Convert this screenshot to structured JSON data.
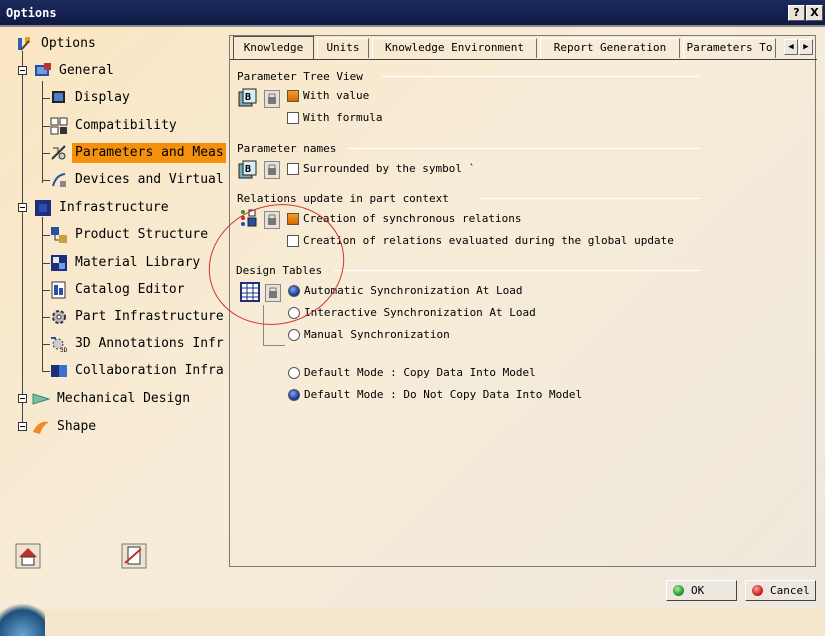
{
  "window": {
    "title": "Options",
    "help_button": "?",
    "close_button": "X"
  },
  "tree": {
    "root": "Options",
    "items": [
      {
        "label": "General",
        "icon": "general-icon"
      },
      {
        "label": "Display",
        "icon": "display-icon"
      },
      {
        "label": "Compatibility",
        "icon": "compatibility-icon"
      },
      {
        "label": "Parameters and Meas",
        "icon": "parameters-icon"
      },
      {
        "label": "Devices and Virtual",
        "icon": "devices-icon"
      },
      {
        "label": "Infrastructure",
        "icon": "infrastructure-icon"
      },
      {
        "label": "Product Structure",
        "icon": "product-structure-icon"
      },
      {
        "label": "Material Library",
        "icon": "material-library-icon"
      },
      {
        "label": "Catalog Editor",
        "icon": "catalog-editor-icon"
      },
      {
        "label": "Part Infrastructure",
        "icon": "part-infrastructure-icon"
      },
      {
        "label": "3D Annotations Infr",
        "icon": "annotations-icon"
      },
      {
        "label": "Collaboration Infra",
        "icon": "collaboration-icon"
      },
      {
        "label": "Mechanical Design",
        "icon": "mechanical-design-icon"
      },
      {
        "label": "Shape",
        "icon": "shape-icon"
      }
    ]
  },
  "tabs": [
    "Knowledge",
    "Units",
    "Knowledge Environment",
    "Report Generation",
    "Parameters To"
  ],
  "groups": {
    "tree_view": {
      "title": "Parameter Tree View",
      "with_value": "With value",
      "with_formula": "With formula"
    },
    "names": {
      "title": "Parameter names",
      "surrounded": "Surrounded by the symbol `"
    },
    "relations": {
      "title": "Relations update in part context",
      "synchronous": "Creation of synchronous relations",
      "evaluated": "Creation of relations evaluated during the global update"
    },
    "design_tables": {
      "title": "Design Tables",
      "auto_sync": "Automatic Synchronization At Load",
      "interactive_sync": "Interactive Synchronization At Load",
      "manual_sync": "Manual Synchronization",
      "copy_mode": "Default Mode : Copy Data Into Model",
      "no_copy_mode": "Default Mode : Do Not Copy Data Into Model"
    }
  },
  "buttons": {
    "ok": "OK",
    "cancel": "Cancel"
  },
  "colors": {
    "selection": "#f4900b",
    "titlebar": "#1c2a5c",
    "checked_box": "#e87c10"
  }
}
